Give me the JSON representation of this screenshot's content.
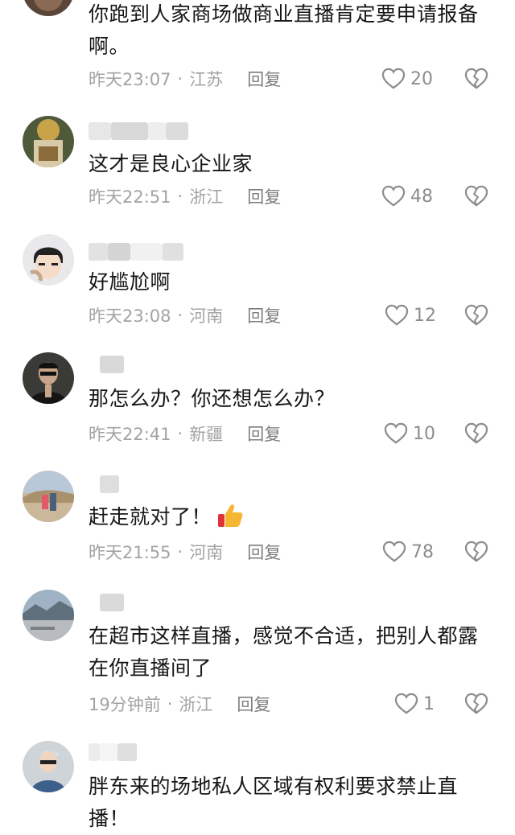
{
  "comments": [
    {
      "text_line1": "你跑到人家商场做商业直播肯定要申请报备",
      "text_line2": "啊。",
      "time": "昨天23:07",
      "dot": "·",
      "location": "江苏",
      "reply": "回复",
      "likes": "20"
    },
    {
      "text_line1": "这才是良心企业家",
      "time": "昨天22:51",
      "dot": "·",
      "location": "浙江",
      "reply": "回复",
      "likes": "48"
    },
    {
      "text_line1": "好尴尬啊",
      "time": "昨天23:08",
      "dot": "·",
      "location": "河南",
      "reply": "回复",
      "likes": "12"
    },
    {
      "text_line1": "那怎么办？你还想怎么办？",
      "time": "昨天22:41",
      "dot": "·",
      "location": "新疆",
      "reply": "回复",
      "likes": "10"
    },
    {
      "text_line1": "赶走就对了！",
      "emoji": "thumbs-up-icon",
      "time": "昨天21:55",
      "dot": "·",
      "location": "河南",
      "reply": "回复",
      "likes": "78"
    },
    {
      "text_line1": "在超市这样直播，感觉不合适，把别人都露",
      "text_line2": "在你直播间了",
      "time": "19分钟前",
      "dot": "·",
      "location": "浙江",
      "reply": "回复",
      "likes": "1"
    },
    {
      "text_line1": "胖东来的场地私人区域有权利要求禁止直",
      "text_line2": "播！"
    }
  ],
  "icons": {
    "like": "heart-outline-icon",
    "dislike": "broken-heart-icon"
  },
  "colors": {
    "text": "#161616",
    "meta": "#a3a3a3",
    "icon": "#8d8d8d"
  }
}
